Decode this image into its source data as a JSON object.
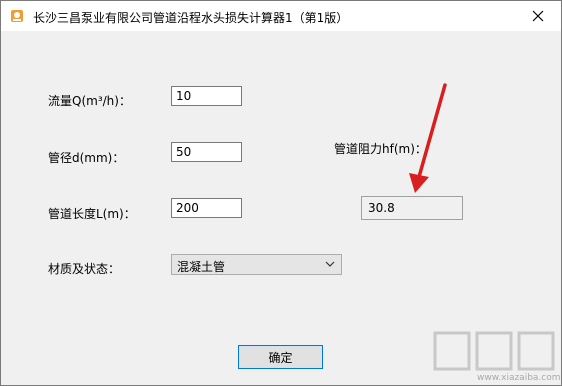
{
  "window": {
    "title": "长沙三昌泵业有限公司管道沿程水头损失计算器1（第1版）"
  },
  "form": {
    "flow": {
      "label": "流量Q(m³/h)：",
      "value": "10"
    },
    "diameter": {
      "label": "管径d(mm)：",
      "value": "50"
    },
    "length": {
      "label": "管道长度L(m)：",
      "value": "200"
    },
    "material": {
      "label": "材质及状态：",
      "selected": "混凝土管"
    }
  },
  "result": {
    "label": "管道阻力hf(m)：",
    "value": "30.8"
  },
  "buttons": {
    "ok": "确定"
  },
  "watermark": {
    "site": "www.xiazaiba.com"
  },
  "colors": {
    "arrow": "#d81e1e",
    "ok_border": "#0078d7"
  }
}
